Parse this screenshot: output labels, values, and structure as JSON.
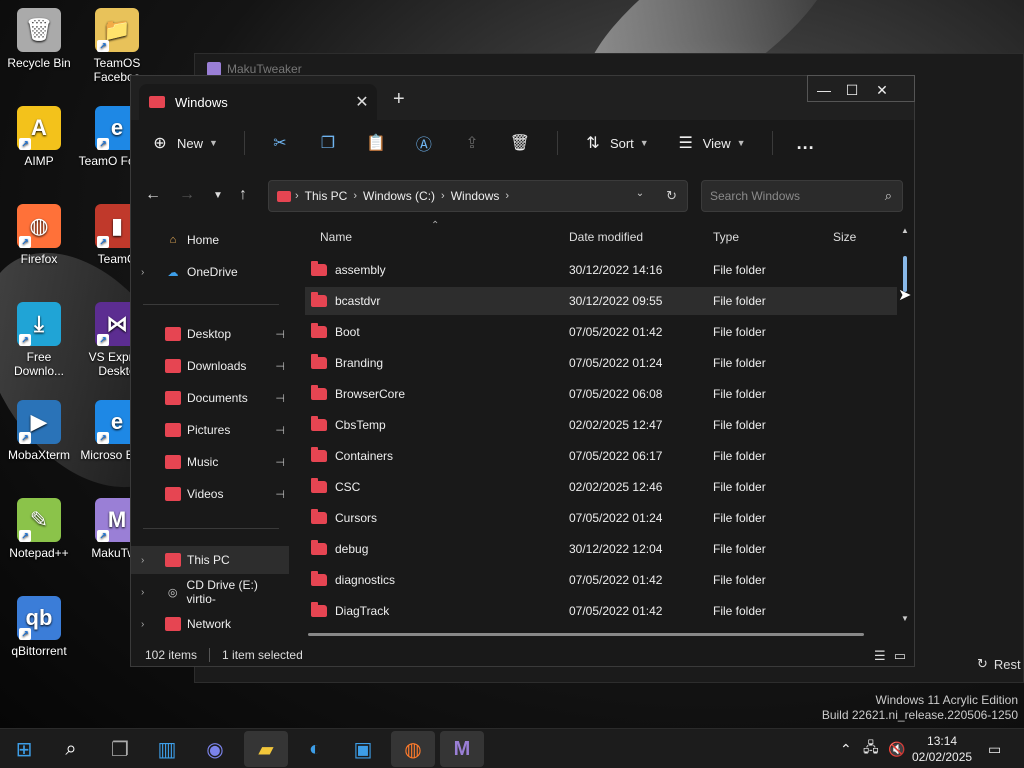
{
  "desktop_icons": [
    {
      "label": "Recycle Bin",
      "icon": "recycle-bin-icon"
    },
    {
      "label": "TeamOS Faceboo",
      "icon": "folder-icon"
    },
    {
      "label": "AIMP",
      "icon": "aimp-icon"
    },
    {
      "label": "TeamO Forum",
      "icon": "edge-icon"
    },
    {
      "label": "Firefox",
      "icon": "firefox-icon"
    },
    {
      "label": "TeamO",
      "icon": "winrar-icon"
    },
    {
      "label": "Free Downlo...",
      "icon": "free-download-manager-icon"
    },
    {
      "label": "VS Expres Deskto",
      "icon": "visual-studio-icon"
    },
    {
      "label": "MobaXterm",
      "icon": "mobaxterm-icon"
    },
    {
      "label": "Microso Edge",
      "icon": "edge-icon"
    },
    {
      "label": "Notepad++",
      "icon": "notepadpp-icon"
    },
    {
      "label": "MakuTwe",
      "icon": "makutweaker-icon"
    },
    {
      "label": "qBittorrent",
      "icon": "qbittorrent-icon"
    }
  ],
  "background_window": {
    "title": "MakuTweaker",
    "restart_label": "Rest"
  },
  "explorer": {
    "tab_title": "Windows",
    "toolbar": {
      "new": "New",
      "sort": "Sort",
      "view": "View",
      "more": "..."
    },
    "breadcrumb": [
      "This PC",
      "Windows (C:)",
      "Windows"
    ],
    "search_placeholder": "Search Windows",
    "sidebar": {
      "home": "Home",
      "onedrive": "OneDrive",
      "quick": [
        "Desktop",
        "Downloads",
        "Documents",
        "Pictures",
        "Music",
        "Videos"
      ],
      "thispc": "This PC",
      "cddrive": "CD Drive (E:) virtio-",
      "network": "Network"
    },
    "columns": {
      "name": "Name",
      "date": "Date modified",
      "type": "Type",
      "size": "Size"
    },
    "rows": [
      {
        "name": "assembly",
        "date": "30/12/2022 14:16",
        "type": "File folder"
      },
      {
        "name": "bcastdvr",
        "date": "30/12/2022 09:55",
        "type": "File folder"
      },
      {
        "name": "Boot",
        "date": "07/05/2022 01:42",
        "type": "File folder"
      },
      {
        "name": "Branding",
        "date": "07/05/2022 01:24",
        "type": "File folder"
      },
      {
        "name": "BrowserCore",
        "date": "07/05/2022 06:08",
        "type": "File folder"
      },
      {
        "name": "CbsTemp",
        "date": "02/02/2025 12:47",
        "type": "File folder"
      },
      {
        "name": "Containers",
        "date": "07/05/2022 06:17",
        "type": "File folder"
      },
      {
        "name": "CSC",
        "date": "02/02/2025 12:46",
        "type": "File folder"
      },
      {
        "name": "Cursors",
        "date": "07/05/2022 01:24",
        "type": "File folder"
      },
      {
        "name": "debug",
        "date": "30/12/2022 12:04",
        "type": "File folder"
      },
      {
        "name": "diagnostics",
        "date": "07/05/2022 01:42",
        "type": "File folder"
      },
      {
        "name": "DiagTrack",
        "date": "07/05/2022 01:42",
        "type": "File folder"
      }
    ],
    "selected_row": 1,
    "status": {
      "items": "102 items",
      "selected": "1 item selected"
    }
  },
  "watermark": {
    "line1": "Windows 11 Acrylic Edition",
    "line2": "Build 22621.ni_release.220506-1250"
  },
  "taskbar": {
    "time": "13:14",
    "date": "02/02/2025"
  }
}
